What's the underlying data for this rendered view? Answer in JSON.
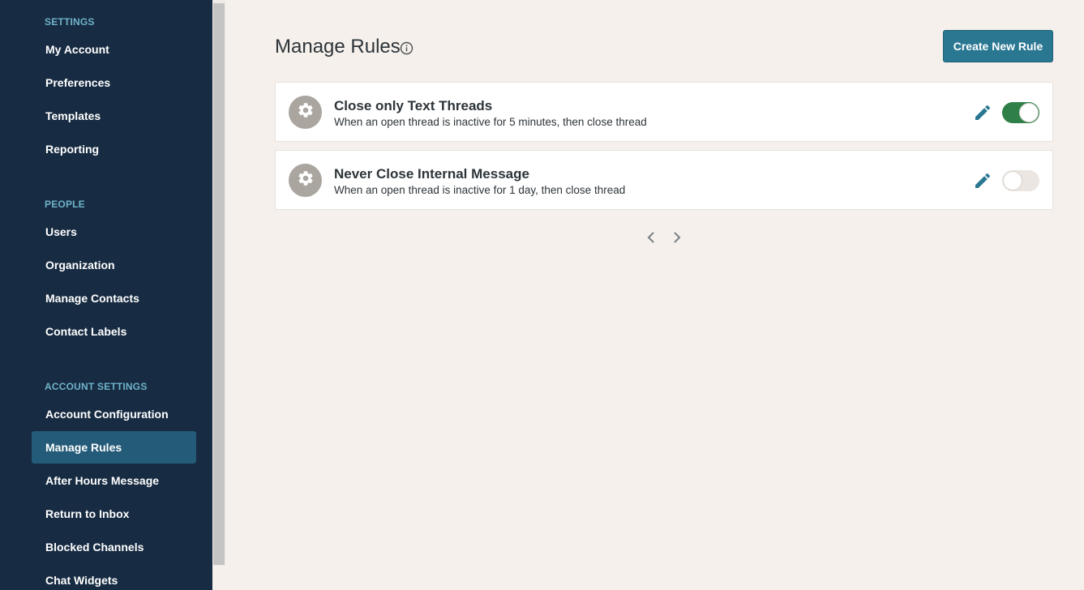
{
  "sidebar": {
    "sections": [
      {
        "header": "SETTINGS",
        "items": [
          "My Account",
          "Preferences",
          "Templates",
          "Reporting"
        ]
      },
      {
        "header": "PEOPLE",
        "items": [
          "Users",
          "Organization",
          "Manage Contacts",
          "Contact Labels"
        ]
      },
      {
        "header": "ACCOUNT SETTINGS",
        "items": [
          "Account Configuration",
          "Manage Rules",
          "After Hours Message",
          "Return to Inbox",
          "Blocked Channels",
          "Chat Widgets"
        ]
      }
    ],
    "active_item": "Manage Rules"
  },
  "main": {
    "title": "Manage Rules",
    "create_button_label": "Create New Rule",
    "rules": [
      {
        "title": "Close only Text Threads",
        "description": "When an open thread is inactive for 5 minutes, then close thread",
        "enabled": true
      },
      {
        "title": "Never Close Internal Message",
        "description": "When an open thread is inactive for 1 day, then close thread",
        "enabled": false
      }
    ]
  },
  "colors": {
    "sidebar_bg": "#172b42",
    "section_header": "#6fb3c9",
    "active_item_bg": "#245b78",
    "accent": "#2a7792",
    "toggle_on": "#2e8048",
    "page_bg": "#f5f0eb"
  },
  "icons": [
    "info-icon",
    "gear-icon",
    "pencil-icon",
    "chevron-left-icon",
    "chevron-right-icon"
  ]
}
